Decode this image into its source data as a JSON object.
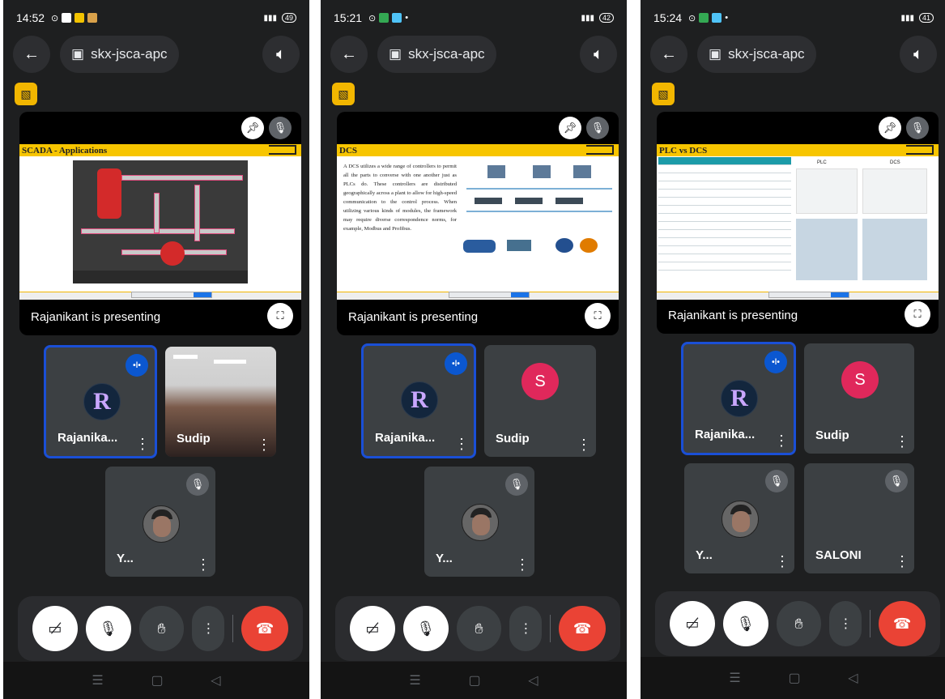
{
  "screens": [
    {
      "status": {
        "time": "14:52",
        "battery": "49",
        "net": "4G"
      },
      "meeting_code": "skx-jsca-apc",
      "slide_title": "SCADA - Applications",
      "presenting_text": "Rajanikant is presenting",
      "tiles": [
        {
          "name": "Rajanika...",
          "avatar": "R"
        },
        {
          "name": "Sudip"
        },
        {
          "name": "Y..."
        }
      ]
    },
    {
      "status": {
        "time": "15:21",
        "battery": "42",
        "net": "4G"
      },
      "meeting_code": "skx-jsca-apc",
      "slide_title": "DCS",
      "slide_body": "A DCS utilizes a wide range of controllers to permit all the parts to converse with one another just as PLCs do. These controllers are distributed geographically across a plant to allow for high-speed communication to the control process. When utilizing various kinds of modules, the framework may require diverse correspondence norms, for example, Modbus and Profibus.",
      "presenting_text": "Rajanikant is presenting",
      "tiles": [
        {
          "name": "Rajanika...",
          "avatar": "R"
        },
        {
          "name": "Sudip",
          "avatar": "S"
        },
        {
          "name": "Y..."
        }
      ]
    },
    {
      "status": {
        "time": "15:24",
        "battery": "41",
        "net": "4G"
      },
      "meeting_code": "skx-jsca-apc",
      "slide_title": "PLC vs DCS",
      "slide_col_plc": "PLC",
      "slide_col_dcs": "DCS",
      "presenting_text": "Rajanikant is presenting",
      "tiles": [
        {
          "name": "Rajanika...",
          "avatar": "R"
        },
        {
          "name": "Sudip",
          "avatar": "S"
        },
        {
          "name": "Y..."
        },
        {
          "name": "SALONI"
        }
      ]
    }
  ],
  "colors": {
    "accent": "#1a4fd6",
    "end_call": "#ea4335",
    "badge": "#f2b600",
    "sudip_avatar": "#e0285b"
  },
  "icons": [
    "back-arrow-icon",
    "calendar-icon",
    "speaker-icon",
    "camera-off-icon",
    "pin-icon",
    "mic-off-icon",
    "fullscreen-icon",
    "more-vert-icon",
    "hand-icon",
    "end-call-icon",
    "speaking-icon"
  ]
}
